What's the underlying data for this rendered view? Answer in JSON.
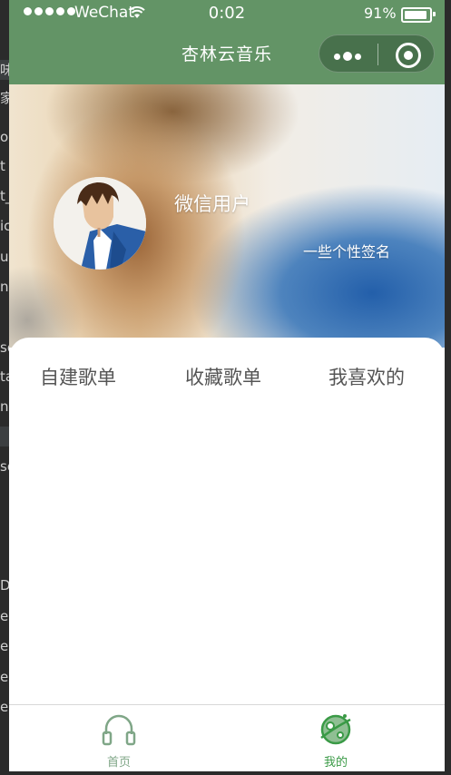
{
  "status_bar": {
    "carrier": "WeChat",
    "time": "0:02",
    "battery_percent": "91%",
    "battery_level": 0.91,
    "icons": [
      "signal-dots-icon",
      "wifi-icon",
      "battery-icon"
    ]
  },
  "nav": {
    "title": "杏林云音乐",
    "capsule_icons": [
      "more-dots-icon",
      "close-target-icon"
    ],
    "bg_color": "#639466"
  },
  "profile": {
    "username": "微信用户",
    "signature": "一些个性签名",
    "avatar_icon": "avatar-image"
  },
  "tabs": [
    {
      "label": "自建歌单"
    },
    {
      "label": "收藏歌单"
    },
    {
      "label": "我喜欢的"
    }
  ],
  "tabbar": {
    "items": [
      {
        "label": "首页",
        "icon": "headphones-icon",
        "active": false,
        "color": "#7fa687"
      },
      {
        "label": "我的",
        "icon": "planet-icon",
        "active": true,
        "color": "#3a9a46"
      }
    ]
  },
  "background_editor": {
    "lines": [
      "",
      "味",
      "家",
      "o",
      "t",
      "t_",
      "ic",
      "u",
      "n",
      "",
      "so",
      "ta",
      "n",
      "",
      "so",
      "",
      "",
      "D",
      "er",
      "er",
      "er",
      "er"
    ]
  }
}
